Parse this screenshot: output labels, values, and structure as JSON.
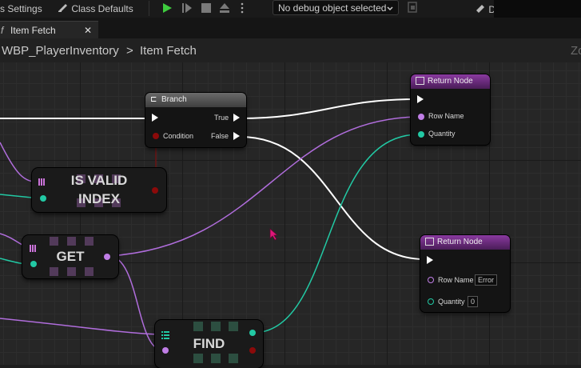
{
  "toolbar": {
    "settings_label": "s Settings",
    "class_defaults_label": "Class Defaults",
    "debug_select_value": "No debug object selected",
    "partial_label": "D"
  },
  "tab": {
    "label": "Item Fetch"
  },
  "breadcrumb": {
    "root": "WBP_PlayerInventory",
    "separator": ">",
    "current": "Item Fetch",
    "right_partial": "Zo"
  },
  "nodes": {
    "branch": {
      "title": "Branch",
      "true_label": "True",
      "false_label": "False",
      "condition_label": "Condition"
    },
    "return_true": {
      "title": "Return Node",
      "row_name_label": "Row Name",
      "quantity_label": "Quantity"
    },
    "return_false": {
      "title": "Return Node",
      "row_name_label": "Row Name",
      "row_name_value": "Error",
      "quantity_label": "Quantity",
      "quantity_value": "0"
    },
    "is_valid": {
      "line1": "IS VALID",
      "line2": "INDEX"
    },
    "get": {
      "title": "GET"
    },
    "find": {
      "title": "FIND"
    }
  },
  "colors": {
    "exec_wire": "#ffffff",
    "name_pin": "#c07ee6",
    "int_pin": "#22c9a4",
    "bool_pin": "#8b0a0a",
    "return_header": "#7a2f8e",
    "play_green": "#3ecb3e",
    "cursor": "#e0177a"
  },
  "icons": [
    "blueprint-settings-icon",
    "class-defaults-icon",
    "play-icon",
    "step-icon",
    "stop-icon",
    "eject-icon",
    "more-icon",
    "chevron-down-icon",
    "debug-filter-icon",
    "branch-icon",
    "function-icon",
    "array-grid-icon",
    "close-icon",
    "mouse-cursor-icon"
  ]
}
